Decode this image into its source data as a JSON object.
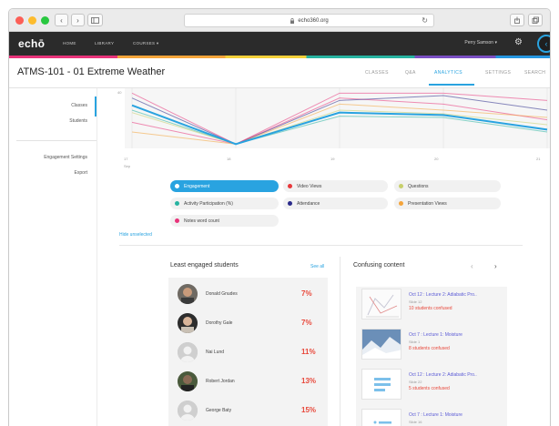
{
  "browser": {
    "url": "echo360.org",
    "back": "‹",
    "forward": "›"
  },
  "nav": {
    "logo": "echō",
    "links": [
      "HOME",
      "LIBRARY",
      "COURSES"
    ],
    "courses_caret": "▾",
    "user": "Perry Samson",
    "user_caret": "▾"
  },
  "course": {
    "title": "ATMS-101 - 01 Extreme Weather",
    "tabs": [
      "CLASSES",
      "Q&A",
      "ANALYTICS",
      "SETTINGS",
      "SEARCH"
    ],
    "active_tab": "ANALYTICS"
  },
  "sidebar": {
    "items": [
      "Classes",
      "Students",
      "Engagement Settings",
      "Export"
    ],
    "active": "Classes"
  },
  "chart_data": {
    "type": "line",
    "y_tick_label": "40",
    "x_tick_labels": [
      "17",
      "18",
      "19",
      "20",
      "21"
    ],
    "x_axis_unit": "Sep",
    "series": [
      {
        "name": "Engagement",
        "color": "#29a3e0",
        "values": [
          34,
          2,
          28,
          26,
          14
        ]
      },
      {
        "name": "Activity Participation (%)",
        "color": "#27b3a1",
        "values": [
          30,
          2,
          25,
          24,
          12
        ]
      },
      {
        "name": "Video Views",
        "color": "#e8337a",
        "values": [
          20,
          2,
          40,
          35,
          22
        ]
      },
      {
        "name": "Attendance",
        "color": "#2a2a8a",
        "values": [
          40,
          2,
          38,
          42,
          30
        ]
      },
      {
        "name": "Questions",
        "color": "#c7cf6b",
        "values": [
          28,
          2,
          30,
          27,
          18
        ]
      },
      {
        "name": "Presentation Views",
        "color": "#f4a43a",
        "values": [
          12,
          2,
          35,
          30,
          24
        ]
      },
      {
        "name": "Notes word count",
        "color": "#e8337a",
        "values": [
          44,
          2,
          44,
          44,
          38
        ]
      }
    ]
  },
  "legend": {
    "items": [
      {
        "label": "Engagement",
        "color": "#29a3e0",
        "selected": true
      },
      {
        "label": "Video Views",
        "color": "#e8383b",
        "selected": false
      },
      {
        "label": "Questions",
        "color": "#c7cf6b",
        "selected": false
      },
      {
        "label": "Activity Participation (%)",
        "color": "#27b3a1",
        "selected": false
      },
      {
        "label": "Attendance",
        "color": "#2a2a8a",
        "selected": false
      },
      {
        "label": "Presentation Views",
        "color": "#f4a43a",
        "selected": false
      },
      {
        "label": "Notes word count",
        "color": "#e8337a",
        "selected": false
      }
    ],
    "hide_unselected": "Hide unselected"
  },
  "least_engaged": {
    "title": "Least engaged students",
    "see_all": "See all",
    "students": [
      {
        "name": "Donald Gnudes",
        "pct": "7%"
      },
      {
        "name": "Dorothy Gale",
        "pct": "7%"
      },
      {
        "name": "Nai Lund",
        "pct": "11%"
      },
      {
        "name": "Robert Jordan",
        "pct": "13%"
      },
      {
        "name": "George Baty",
        "pct": "15%"
      }
    ]
  },
  "confusing": {
    "title": "Confusing content",
    "prev": "‹",
    "next": "›",
    "items": [
      {
        "title": "Oct 12 : Lecture 2: Adiabatic Pro..",
        "slide": "Slide 12",
        "confused": "10 students confused"
      },
      {
        "title": "Oct 7 : Lecture 1: Moisture",
        "slide": "Slide 1",
        "confused": "8 students confused"
      },
      {
        "title": "Oct 12 : Lecture 2: Adiabatic Pro..",
        "slide": "Slide 22",
        "confused": "5 students confused"
      },
      {
        "title": "Oct 7 : Lecture 1: Moisture",
        "slide": "Slide 16",
        "confused": ""
      }
    ]
  }
}
